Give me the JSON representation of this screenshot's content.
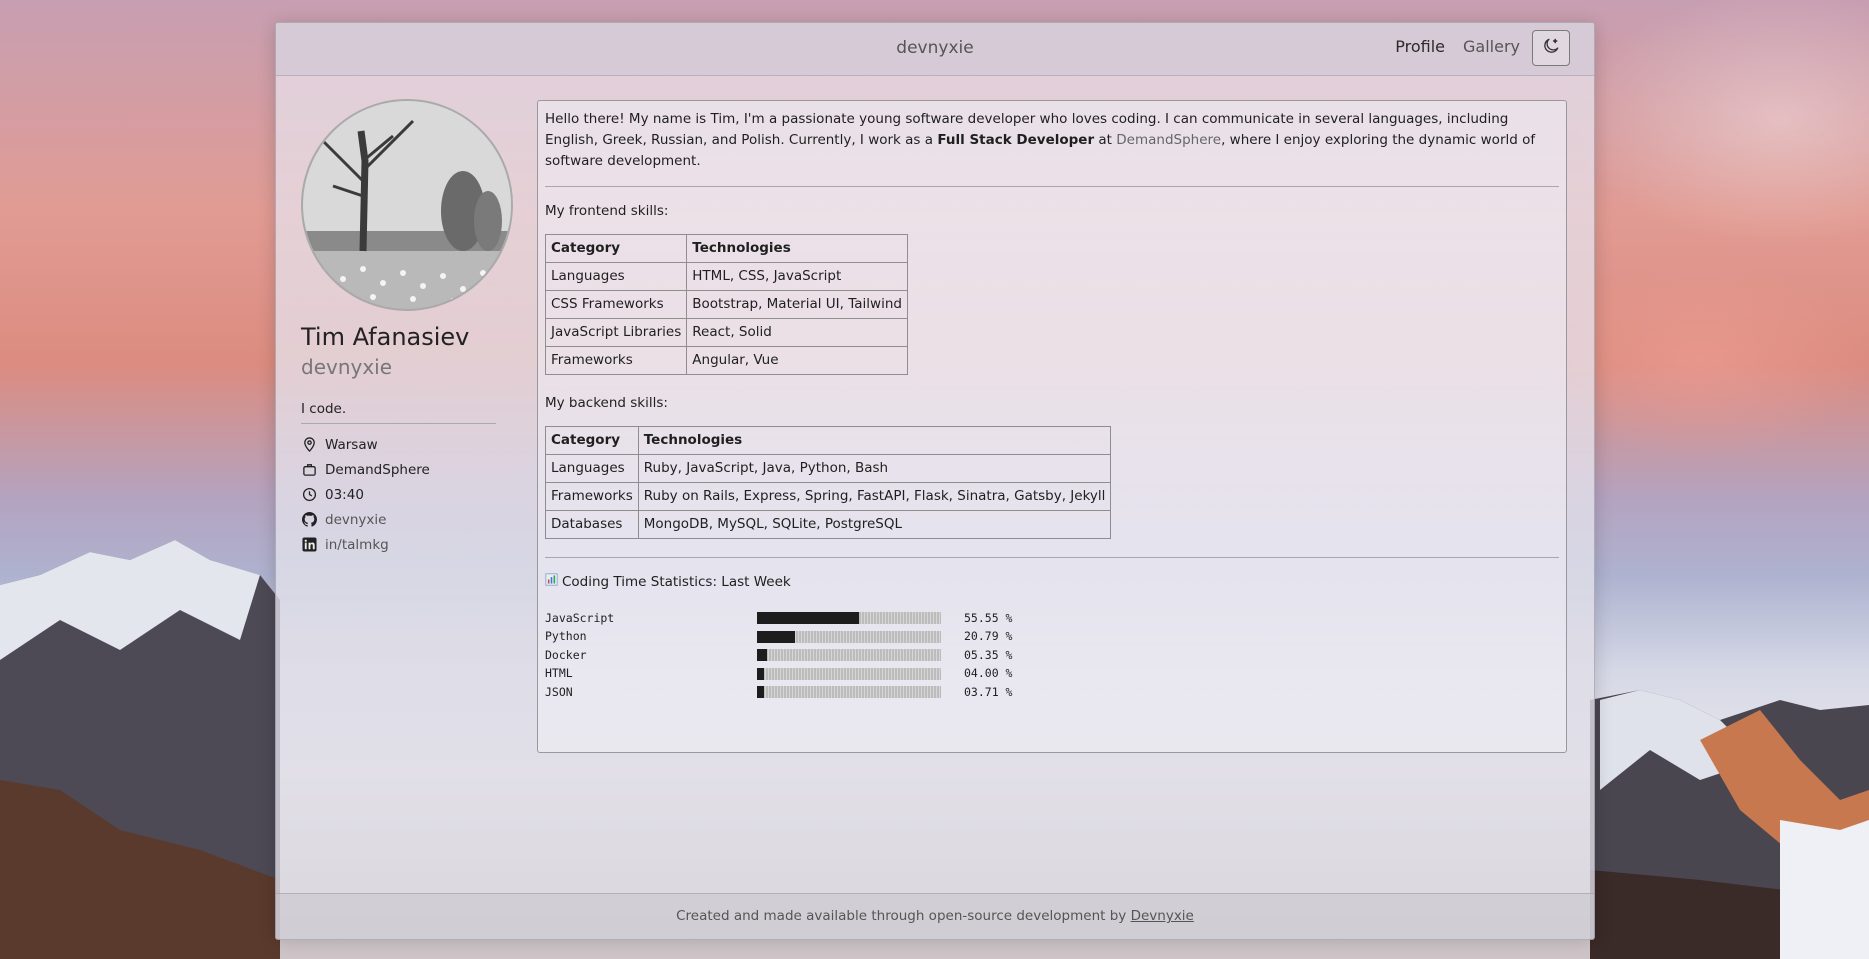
{
  "header": {
    "title": "devnyxie",
    "nav": [
      {
        "label": "Profile"
      },
      {
        "label": "Gallery"
      }
    ],
    "theme_toggle_icon": "moon-icon"
  },
  "sidebar": {
    "full_name": "Tim Afanasiev",
    "username": "devnyxie",
    "bio": "I code.",
    "info": {
      "location": "Warsaw",
      "company": "DemandSphere",
      "time": "03:40",
      "github": "devnyxie",
      "linkedin": "in/talmkg"
    }
  },
  "main": {
    "intro": {
      "text_before": "Hello there! My name is Tim, I'm a passionate young software developer who loves coding. I can communicate in several languages, including English, Greek, Russian, and Polish. Currently, I work as a ",
      "role": "Full Stack Developer",
      "text_at": " at ",
      "company_link": "DemandSphere",
      "text_after": ", where I enjoy exploring the dynamic world of software development."
    },
    "frontend_label": "My frontend skills:",
    "frontend_table": {
      "headers": [
        "Category",
        "Technologies"
      ],
      "rows": [
        [
          "Languages",
          "HTML, CSS, JavaScript"
        ],
        [
          "CSS Frameworks",
          "Bootstrap, Material UI, Tailwind"
        ],
        [
          "JavaScript Libraries",
          "React, Solid"
        ],
        [
          "Frameworks",
          "Angular, Vue"
        ]
      ]
    },
    "backend_label": "My backend skills:",
    "backend_table": {
      "headers": [
        "Category",
        "Technologies"
      ],
      "rows": [
        [
          "Languages",
          "Ruby, JavaScript, Java, Python, Bash"
        ],
        [
          "Frameworks",
          "Ruby on Rails, Express, Spring, FastAPI, Flask, Sinatra, Gatsby, Jekyll"
        ],
        [
          "Databases",
          "MongoDB, MySQL, SQLite, PostgreSQL"
        ]
      ]
    },
    "stats_title": "Coding Time Statistics: Last Week",
    "stats": [
      {
        "lang": "JavaScript",
        "pct_label": "55.55 %",
        "value": 55.55
      },
      {
        "lang": "Python",
        "pct_label": "20.79 %",
        "value": 20.79
      },
      {
        "lang": "Docker",
        "pct_label": "05.35 %",
        "value": 5.35
      },
      {
        "lang": "HTML",
        "pct_label": "04.00 %",
        "value": 4.0
      },
      {
        "lang": "JSON",
        "pct_label": "03.71 %",
        "value": 3.71
      }
    ]
  },
  "footer": {
    "text": "Created and made available through open-source development by ",
    "link": "Devnyxie"
  }
}
